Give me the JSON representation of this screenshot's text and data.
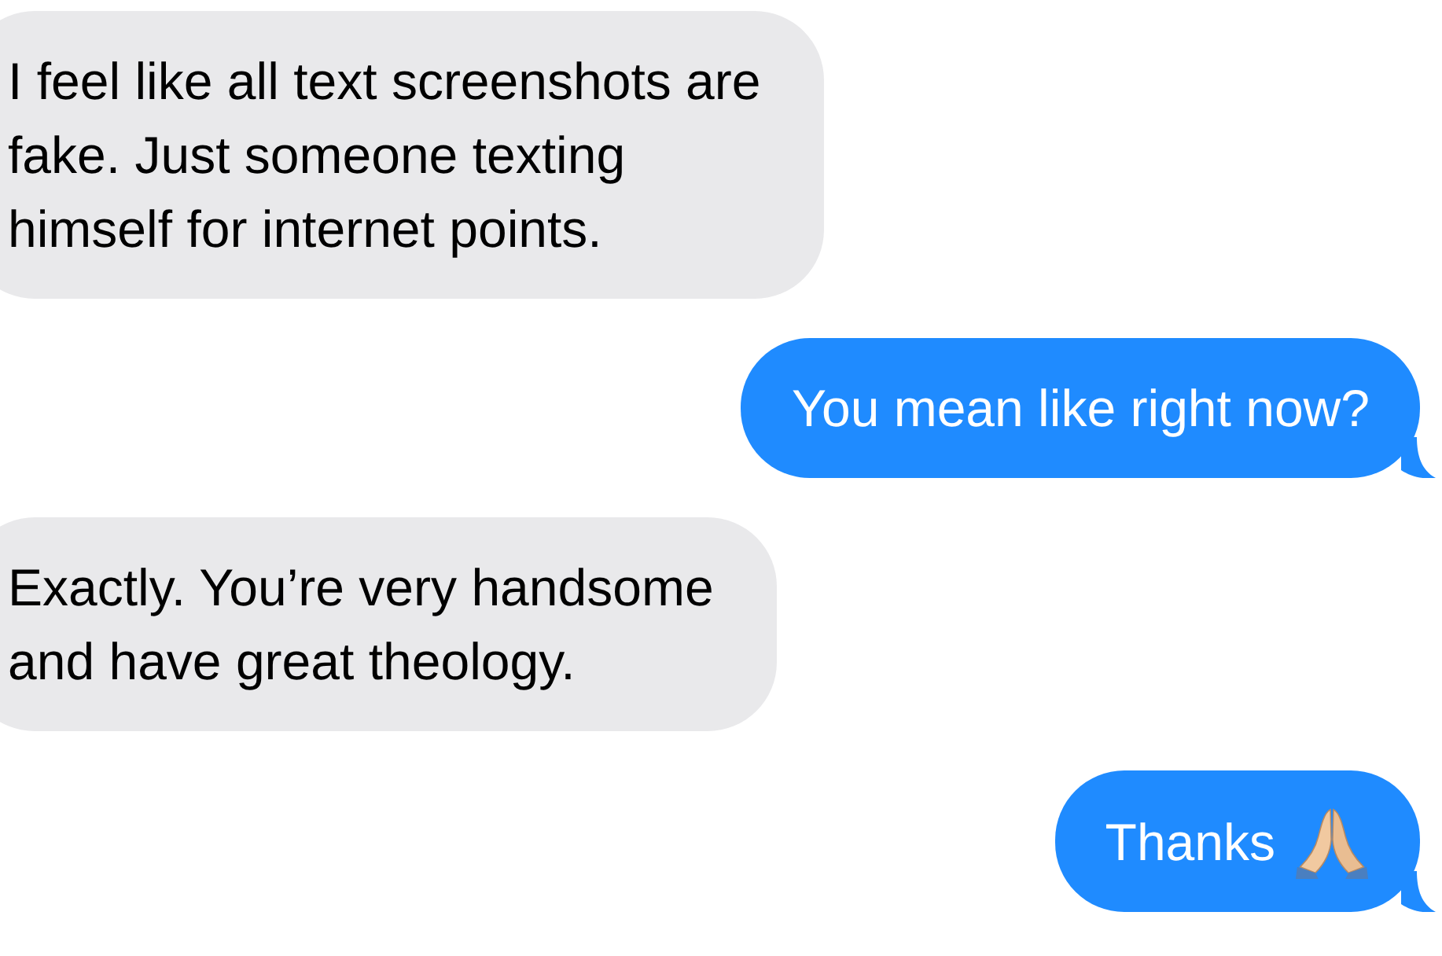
{
  "messages": [
    {
      "kind": "received",
      "text": "I feel like all text screenshots are\nfake. Just someone texting\nhimself for internet points.",
      "has_emoji": false
    },
    {
      "kind": "sent",
      "text": "You mean like right now?",
      "has_emoji": false
    },
    {
      "kind": "received",
      "text": "Exactly. You’re very handsome\nand have great theology.",
      "has_emoji": false
    },
    {
      "kind": "sent",
      "text": "Thanks",
      "has_emoji": true
    }
  ]
}
